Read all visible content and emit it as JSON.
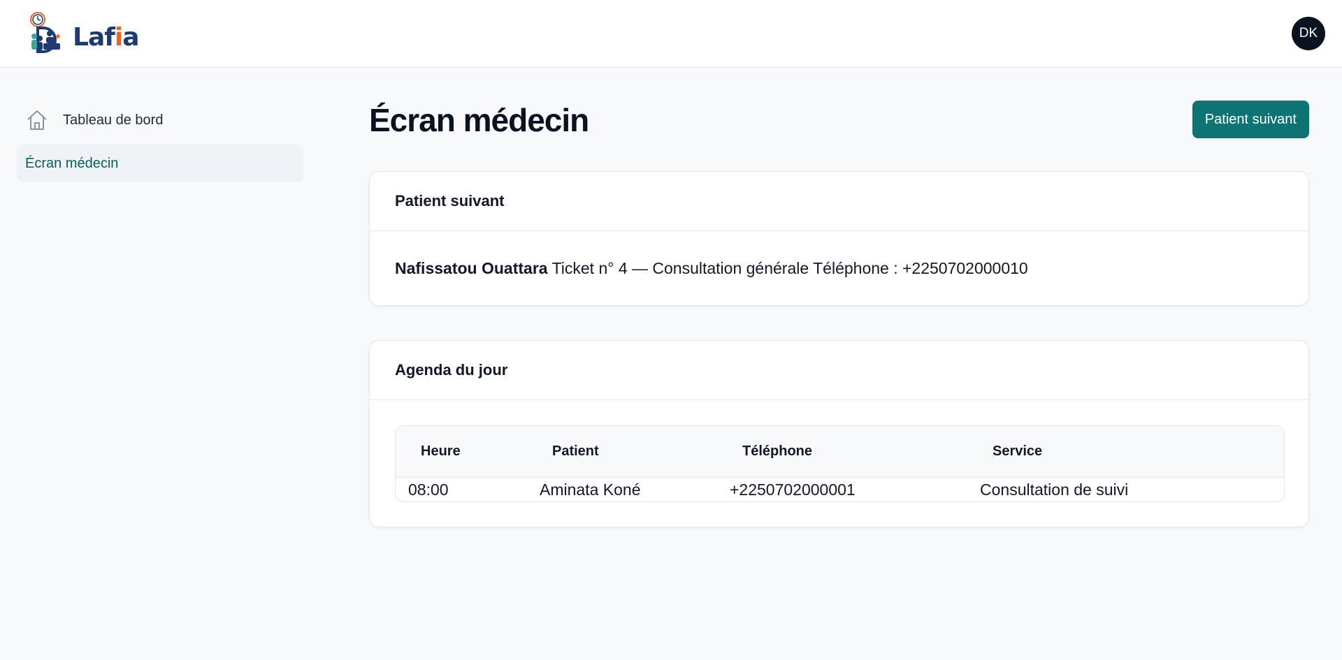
{
  "app": {
    "logo_text_start": "Laf",
    "logo_text_accent": "i",
    "logo_text_end": "a",
    "avatar_initials": "DK"
  },
  "sidebar": {
    "items": [
      {
        "label": "Tableau de bord",
        "icon": "home-icon",
        "active": false
      },
      {
        "label": "Écran médecin",
        "active": true
      }
    ]
  },
  "main": {
    "title": "Écran médecin",
    "next_patient_button": "Patient suivant"
  },
  "next_patient_card": {
    "title": "Patient suivant",
    "patient_name": "Nafissatou Ouattara",
    "details": "Ticket n° 4 — Consultation générale Téléphone : +2250702000010"
  },
  "agenda_card": {
    "title": "Agenda du jour",
    "columns": [
      "Heure",
      "Patient",
      "Téléphone",
      "Service"
    ],
    "rows": [
      [
        "08:00",
        "Aminata Koné",
        "+2250702000001",
        "Consultation de suivi"
      ]
    ]
  },
  "colors": {
    "primary": "#0e7473",
    "brand_navy": "#1e3a6e",
    "brand_orange": "#e8662c",
    "active_nav_text": "#0d5c5a"
  }
}
